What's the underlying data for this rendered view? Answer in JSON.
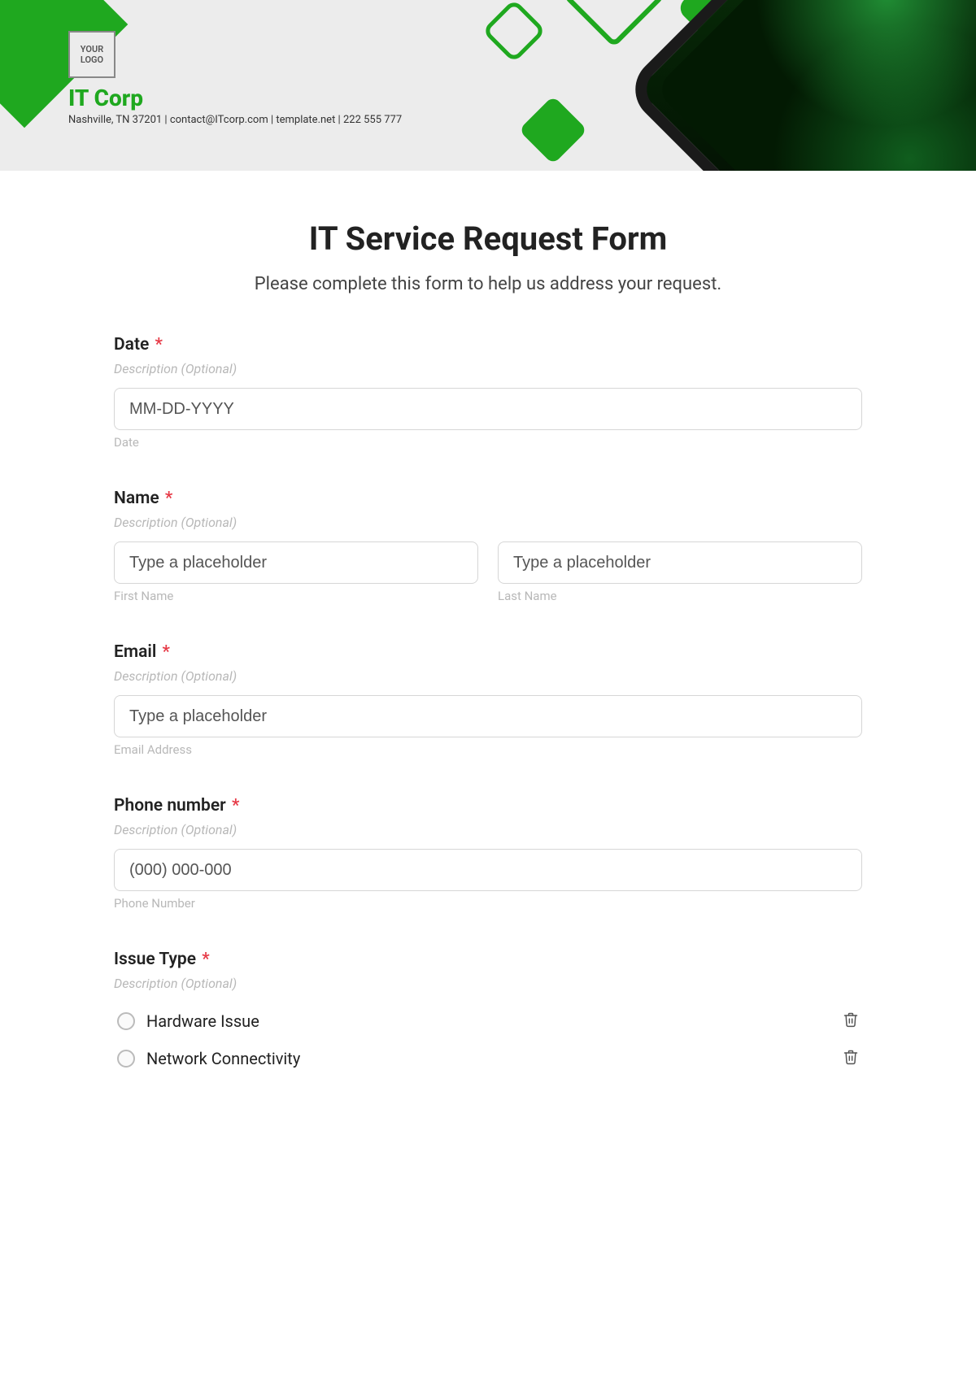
{
  "header": {
    "logo_text": "YOUR LOGO",
    "company_name": "IT Corp",
    "company_info": "Nashville, TN 37201 | contact@ITcorp.com | template.net | 222 555 777"
  },
  "form": {
    "title": "IT Service Request Form",
    "subtitle": "Please complete this form to help us address your request."
  },
  "fields": {
    "date": {
      "label": "Date",
      "required": "*",
      "description": "Description (Optional)",
      "placeholder": "MM-DD-YYYY",
      "sub_label": "Date"
    },
    "name": {
      "label": "Name",
      "required": "*",
      "description": "Description (Optional)",
      "first_placeholder": "Type a placeholder",
      "first_sub": "First Name",
      "last_placeholder": "Type a placeholder",
      "last_sub": "Last Name"
    },
    "email": {
      "label": "Email",
      "required": "*",
      "description": "Description (Optional)",
      "placeholder": "Type a placeholder",
      "sub_label": "Email Address"
    },
    "phone": {
      "label": "Phone number",
      "required": "*",
      "description": "Description (Optional)",
      "placeholder": "(000) 000-000",
      "sub_label": "Phone Number"
    },
    "issue_type": {
      "label": "Issue Type",
      "required": "*",
      "description": "Description (Optional)",
      "options": [
        "Hardware Issue",
        "Network Connectivity"
      ]
    }
  }
}
